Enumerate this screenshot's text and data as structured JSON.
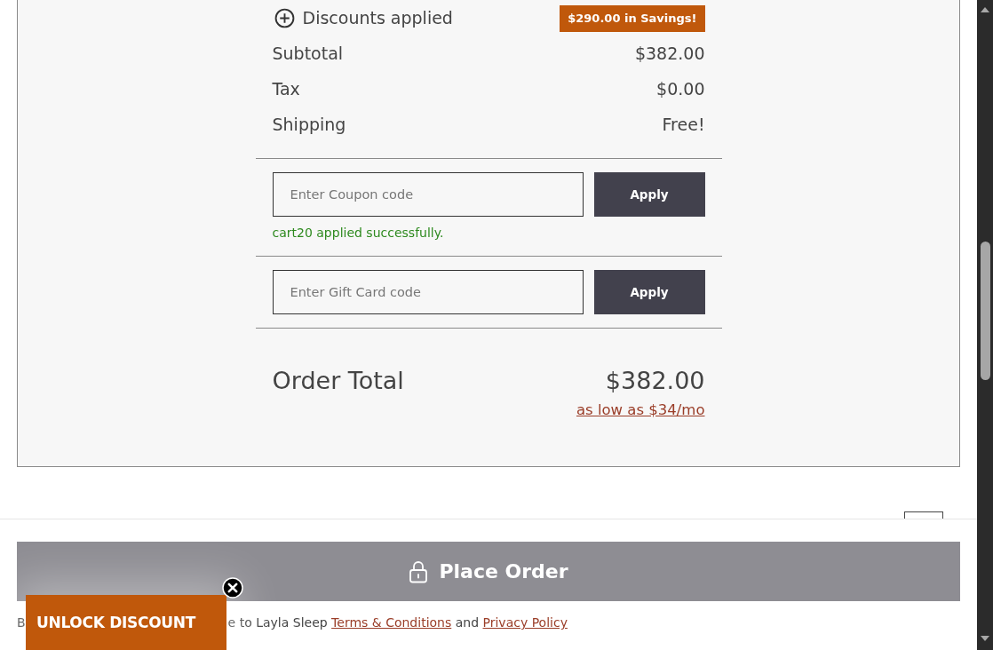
{
  "order_summary": {
    "discounts": {
      "label": "Discounts applied",
      "expanded": false,
      "savings_badge": "$290.00 in Savings!"
    },
    "lines": [
      {
        "label": "Subtotal",
        "value": "$382.00"
      },
      {
        "label": "Tax",
        "value": "$0.00"
      },
      {
        "label": "Shipping",
        "value": "Free!"
      }
    ],
    "coupon": {
      "placeholder": "Enter Coupon code",
      "button": "Apply",
      "message": "cart20 applied successfully."
    },
    "gift_card": {
      "placeholder": "Enter Gift Card code",
      "button": "Apply"
    },
    "order_total": {
      "label": "Order Total",
      "value": "$382.00",
      "financing_link": "as low as $34/mo"
    }
  },
  "checkout": {
    "place_order": {
      "label": "Place Order",
      "disabled": true
    },
    "terms": {
      "start": "B",
      "rest": "e to Layla Sleep",
      "terms_link": "Terms & Conditions",
      "conjunction": "and",
      "privacy_link": "Privacy Policy"
    }
  },
  "discount_popup": {
    "button": "UNLOCK DISCOUNT"
  }
}
